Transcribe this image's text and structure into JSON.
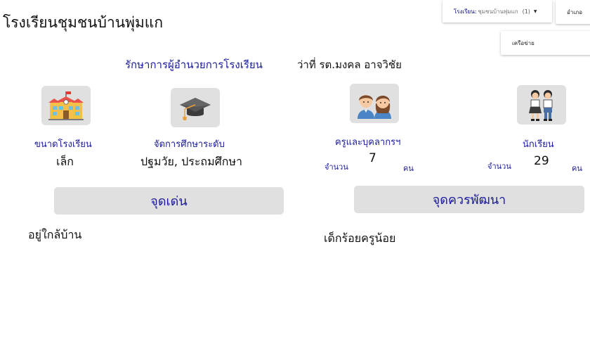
{
  "header": {
    "school_name": "โรงเรียนชุมชนบ้านพุ่มแก",
    "school_select": {
      "label": "โรงเรียน:",
      "value": "ชุมชนบ้านพุ่มแก",
      "count": "(1)"
    },
    "district_button": "อำเภอ",
    "network_menu_item": "เครือข่าย"
  },
  "director": {
    "role": "รักษาการผู้อำนวยการโรงเรียน",
    "name": "ว่าที่ รต.มงคล อาจวิชัย"
  },
  "stats": {
    "school_size": {
      "label": "ขนาดโรงเรียน",
      "value": "เล็ก",
      "icon": "school-building-icon"
    },
    "education_level": {
      "label": "จัดการศึกษาระดับ",
      "value": "ปฐมวัย, ประถมศึกษา",
      "icon": "graduation-cap-icon"
    },
    "teachers": {
      "label": "ครูและบุคลากรฯ",
      "count_label": "จำนวน",
      "count": "7",
      "unit": "คน",
      "icon": "teachers-icon"
    },
    "students": {
      "label": "นักเรียน",
      "count_label": "จำนวน",
      "count": "29",
      "unit": "คน",
      "icon": "students-icon"
    }
  },
  "strengths": {
    "title": "จุดเด่น",
    "text": "อยู่ใกล้บ้าน"
  },
  "improvements": {
    "title": "จุดควรพัฒนา",
    "text": "เด็กร้อยครูน้อย"
  }
}
